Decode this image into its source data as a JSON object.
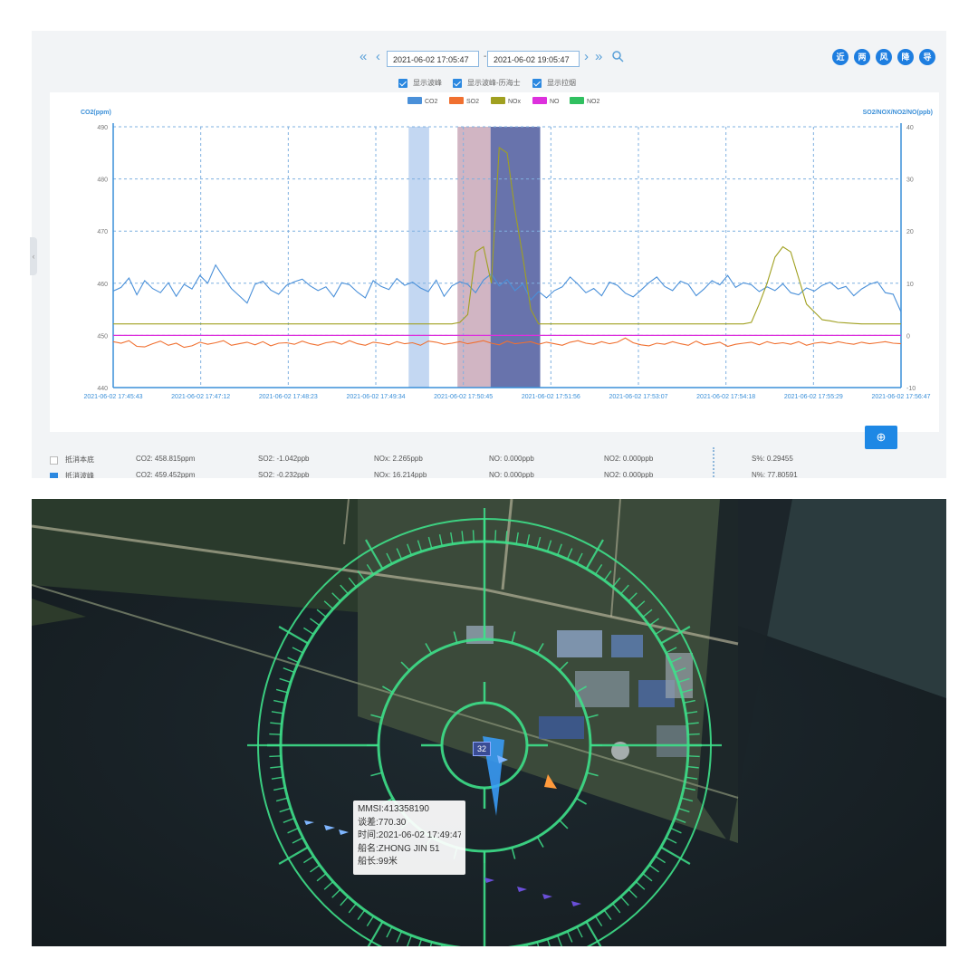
{
  "toolbar": {
    "first_icon": "«",
    "prev_icon": "‹",
    "next_icon": "›",
    "last_icon": "»",
    "start_time": "2021-06-02 17:05:47",
    "end_time": "2021-06-02 19:05:47",
    "separator": "-",
    "right_buttons": [
      "近",
      "两",
      "风",
      "降",
      "导"
    ],
    "accent_color": "#1e7ee0"
  },
  "checkboxes": [
    {
      "label": "显示波峰",
      "checked": true
    },
    {
      "label": "显示波峰-历海士",
      "checked": true
    },
    {
      "label": "显示拉烟",
      "checked": true
    }
  ],
  "chart_data": {
    "type": "line",
    "legend": [
      {
        "name": "CO2",
        "color": "#4a90d9"
      },
      {
        "name": "SO2",
        "color": "#f07030"
      },
      {
        "name": "NOx",
        "color": "#a0a020"
      },
      {
        "name": "NO",
        "color": "#dd30dd"
      },
      {
        "name": "NO2",
        "color": "#30c060"
      }
    ],
    "ylabel_left": "CO2(ppm)",
    "ylabel_right": "SO2/NOX/NO2/NO(ppb)",
    "ylim_left": [
      440,
      490
    ],
    "ylim_right": [
      -10,
      40
    ],
    "yticks_left": [
      440,
      450,
      460,
      470,
      480,
      490
    ],
    "yticks_right": [
      -10,
      0,
      10,
      20,
      30,
      40
    ],
    "xtick_labels": [
      "2021-06-02 17:45:43",
      "2021-06-02 17:47:12",
      "2021-06-02 17:48:23",
      "2021-06-02 17:49:34",
      "2021-06-02 17:50:45",
      "2021-06-02 17:51:56",
      "2021-06-02 17:53:07",
      "2021-06-02 17:54:18",
      "2021-06-02 17:55:29",
      "2021-06-02 17:56:47"
    ],
    "x_index_range": [
      0,
      100
    ],
    "grid": true,
    "highlight_bands": [
      {
        "x0": 37.5,
        "x1": 40.1,
        "color": "#b8d0f0"
      },
      {
        "x0": 43.7,
        "x1": 47.9,
        "color": "#c9a8b8"
      },
      {
        "x0": 47.9,
        "x1": 54.2,
        "color": "#4d5a9e"
      }
    ],
    "series": [
      {
        "name": "CO2",
        "axis": "left",
        "values": [
          458.5,
          459.2,
          461.0,
          457.8,
          460.5,
          459.0,
          458.2,
          460.1,
          457.5,
          459.8,
          458.9,
          461.5,
          460.0,
          463.5,
          461.2,
          459.0,
          457.6,
          456.2,
          459.8,
          460.4,
          458.7,
          457.9,
          459.6,
          460.3,
          460.8,
          459.5,
          458.6,
          459.3,
          457.4,
          460.1,
          459.7,
          458.3,
          457.2,
          460.5,
          459.4,
          458.8,
          460.9,
          459.6,
          460.2,
          459.1,
          458.4,
          460.6,
          457.5,
          459.5,
          460.3,
          459.8,
          458.2,
          460.6,
          461.8,
          459.5,
          460.7,
          458.6,
          459.9,
          456.8,
          458.4,
          457.2,
          458.6,
          459.3,
          461.2,
          459.8,
          458.2,
          459.0,
          457.6,
          460.2,
          459.6,
          458.1,
          457.4,
          458.7,
          460.1,
          461.2,
          459.4,
          458.6,
          460.4,
          459.8,
          457.6,
          458.9,
          460.5,
          459.7,
          461.5,
          459.2,
          460.1,
          459.7,
          458.4,
          459.3,
          458.6,
          459.9,
          458.2,
          457.8,
          459.1,
          458.5,
          459.6,
          460.2,
          458.9,
          459.4,
          457.6,
          458.9,
          459.8,
          460.3,
          458.2,
          457.9,
          454.5
        ]
      },
      {
        "name": "SO2",
        "axis": "right",
        "values": [
          -1.2,
          -1.5,
          -1.0,
          -2.1,
          -2.2,
          -1.6,
          -1.1,
          -1.9,
          -1.5,
          -2.3,
          -2.0,
          -1.3,
          -1.7,
          -1.4,
          -1.0,
          -1.9,
          -1.6,
          -1.3,
          -1.8,
          -1.2,
          -2.0,
          -1.5,
          -1.4,
          -1.7,
          -1.1,
          -1.6,
          -1.9,
          -1.4,
          -1.2,
          -1.7,
          -1.0,
          -1.6,
          -1.9,
          -1.3,
          -1.5,
          -1.8,
          -1.2,
          -1.6,
          -1.4,
          -1.9,
          -1.1,
          -1.3,
          -1.7,
          -1.5,
          -1.2,
          -1.6,
          -1.3,
          -1.0,
          -1.5,
          -1.8,
          -1.1,
          -1.6,
          -1.4,
          -1.2,
          -1.7,
          -1.3,
          -1.6,
          -1.9,
          -1.3,
          -1.0,
          -1.5,
          -1.7,
          -1.2,
          -1.6,
          -1.3,
          -0.5,
          -1.4,
          -1.8,
          -2.0,
          -1.5,
          -1.7,
          -1.2,
          -1.6,
          -1.9,
          -1.1,
          -1.8,
          -1.6,
          -1.3,
          -2.1,
          -1.7,
          -1.5,
          -1.3,
          -1.8,
          -1.2,
          -1.6,
          -1.4,
          -1.7,
          -1.2,
          -1.9,
          -1.5,
          -1.3,
          -1.6,
          -1.2,
          -1.5,
          -1.7,
          -1.3,
          -1.6,
          -1.4,
          -1.2,
          -1.5,
          -1.6
        ]
      },
      {
        "name": "NOx",
        "axis": "right",
        "values": [
          2.2,
          2.2,
          2.2,
          2.2,
          2.2,
          2.2,
          2.2,
          2.2,
          2.2,
          2.2,
          2.2,
          2.2,
          2.2,
          2.2,
          2.2,
          2.2,
          2.2,
          2.2,
          2.2,
          2.2,
          2.2,
          2.2,
          2.2,
          2.2,
          2.2,
          2.2,
          2.2,
          2.2,
          2.2,
          2.2,
          2.2,
          2.2,
          2.2,
          2.2,
          2.2,
          2.2,
          2.2,
          2.2,
          2.2,
          2.2,
          2.2,
          2.2,
          2.2,
          2.2,
          2.5,
          4.0,
          16.0,
          17.0,
          10.0,
          36.0,
          35.0,
          24.0,
          15.0,
          5.0,
          2.2,
          2.2,
          2.2,
          2.2,
          2.2,
          2.2,
          2.2,
          2.2,
          2.2,
          2.2,
          2.2,
          2.2,
          2.2,
          2.2,
          2.2,
          2.2,
          2.2,
          2.2,
          2.2,
          2.2,
          2.2,
          2.2,
          2.2,
          2.2,
          2.2,
          2.2,
          2.2,
          2.5,
          6.0,
          10.0,
          15.0,
          17.0,
          16.0,
          11.0,
          6.0,
          4.5,
          3.0,
          2.8,
          2.5,
          2.4,
          2.3,
          2.2,
          2.2,
          2.2,
          2.2,
          2.2,
          2.2
        ]
      },
      {
        "name": "NO",
        "axis": "right",
        "values": [
          0,
          0,
          0,
          0,
          0,
          0,
          0,
          0,
          0,
          0,
          0,
          0,
          0,
          0,
          0,
          0,
          0,
          0,
          0,
          0,
          0,
          0,
          0,
          0,
          0,
          0,
          0,
          0,
          0,
          0,
          0,
          0,
          0,
          0,
          0,
          0,
          0,
          0,
          0,
          0,
          0,
          0,
          0,
          0,
          0,
          0,
          0,
          0,
          0,
          0,
          0,
          0,
          0,
          0,
          0,
          0,
          0,
          0,
          0,
          0,
          0,
          0,
          0,
          0,
          0,
          0,
          0,
          0,
          0,
          0,
          0,
          0,
          0,
          0,
          0,
          0,
          0,
          0,
          0,
          0,
          0,
          0,
          0,
          0,
          0,
          0,
          0,
          0,
          0,
          0,
          0,
          0,
          0,
          0,
          0,
          0,
          0,
          0,
          0,
          0,
          0
        ]
      }
    ]
  },
  "stats": [
    {
      "checked": false,
      "label": "抵消本底",
      "co2": "CO2: 458.815ppm",
      "so2": "SO2: -1.042ppb",
      "nox": "NOx: 2.265ppb",
      "no": "NO: 0.000ppb",
      "no2": "NO2: 0.000ppb",
      "extra": "S%: 0.29455"
    },
    {
      "checked": true,
      "label": "抵消波峰",
      "co2": "CO2: 459.452ppm",
      "so2": "SO2: -0.232ppb",
      "nox": "NOx: 16.214ppb",
      "no": "NO: 0.000ppb",
      "no2": "NO2: 0.000ppb",
      "extra": "N%: 77.80591"
    }
  ],
  "corner_button_icon": "⊕",
  "left_handle_icon": "‹",
  "map": {
    "ship_label": "32",
    "tooltip": {
      "mmsi": "MMSI:413358190",
      "line2": "谈差:770.30",
      "time": "时间:2021-06-02 17:49:47",
      "name": "船名:ZHONG JIN 51",
      "length": "船长:99米"
    },
    "radar_color": "#3ee08a"
  }
}
